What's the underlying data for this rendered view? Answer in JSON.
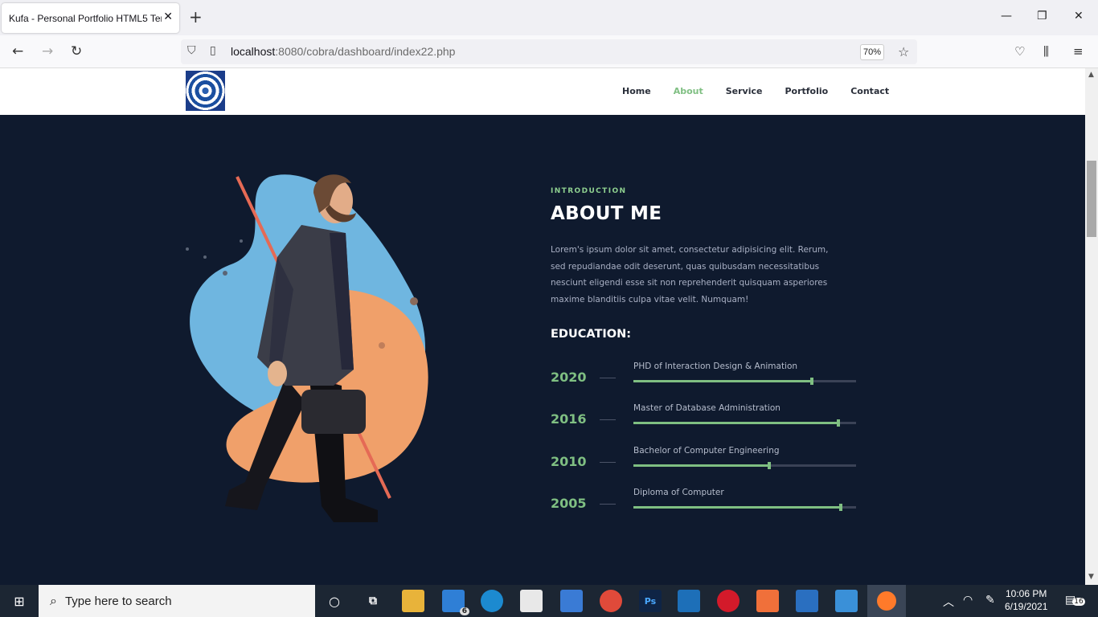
{
  "browser": {
    "tab_title": "Kufa - Personal Portfolio HTML5 Template",
    "url_host": "localhost",
    "url_path": ":8080/cobra/dashboard/index22.php",
    "zoom": "70%"
  },
  "site": {
    "menu": [
      "Home",
      "About",
      "Service",
      "Portfolio",
      "Contact"
    ],
    "active_menu": "About",
    "intro_label": "INTRODUCTION",
    "title": "ABOUT ME",
    "description": "Lorem's ipsum dolor sit amet, consectetur adipisicing elit. Rerum, sed repudiandae odit deserunt, quas quibusdam necessitatibus nesciunt eligendi esse sit non reprehenderit quisquam asperiores maxime blanditiis culpa vitae velit. Numquam!",
    "education_title": "EDUCATION:",
    "education": [
      {
        "year": "2020",
        "degree": "PHD of Interaction Design & Animation",
        "progress": 0.8
      },
      {
        "year": "2016",
        "degree": "Master of Database Administration",
        "progress": 0.92
      },
      {
        "year": "2010",
        "degree": "Bachelor of Computer Engineering",
        "progress": 0.61
      },
      {
        "year": "2005",
        "degree": "Diploma of Computer",
        "progress": 0.93
      }
    ]
  },
  "taskbar": {
    "search_placeholder": "Type here to search",
    "mail_badge": "6",
    "time": "10:06 PM",
    "date": "6/19/2021",
    "notification_count": "16"
  },
  "colors": {
    "accent_green": "#7fbf82",
    "page_bg": "#0f1a2e"
  }
}
